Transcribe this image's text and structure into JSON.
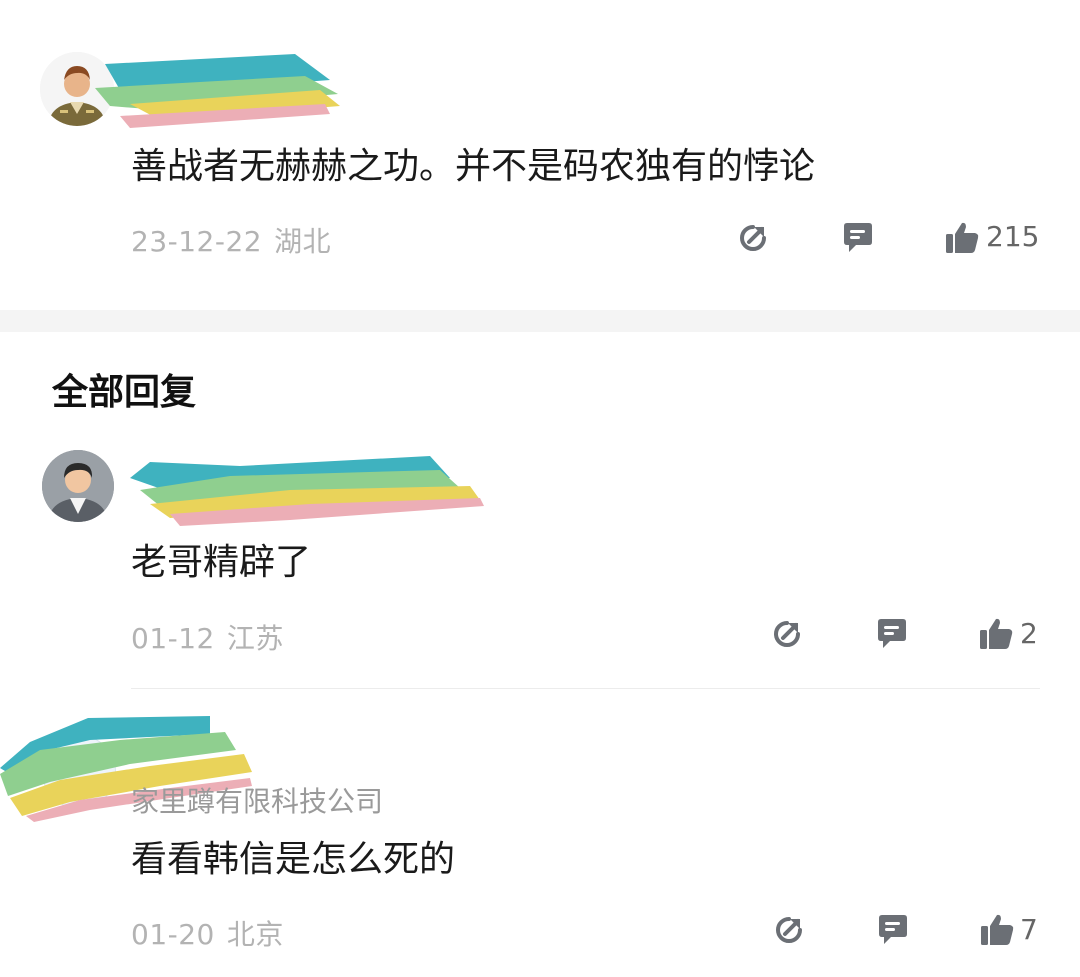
{
  "comments_top": {
    "text": "善战者无赫赫之功。并不是码农独有的悖论",
    "date": "23-12-22",
    "location": "湖北",
    "likes": "215"
  },
  "replies_section": {
    "title": "全部回复"
  },
  "replies": [
    {
      "text": "老哥精辟了",
      "date": "01-12",
      "location": "江苏",
      "likes": "2"
    },
    {
      "subtitle": "家里蹲有限科技公司",
      "text": "看看韩信是怎么死的",
      "date": "01-20",
      "location": "北京",
      "likes": "7"
    }
  ],
  "icons": {
    "share": "share-arrow-icon",
    "reply": "comment-bubble-icon",
    "like": "thumbs-up-icon"
  },
  "colors": {
    "meta_text": "#b3b3b3",
    "icon_gray": "#6b6f75",
    "scribble_teal": "#3fb2bf",
    "scribble_green": "#8fcf8f",
    "scribble_yellow": "#e9d35a",
    "scribble_pink": "#ecaeb6"
  }
}
